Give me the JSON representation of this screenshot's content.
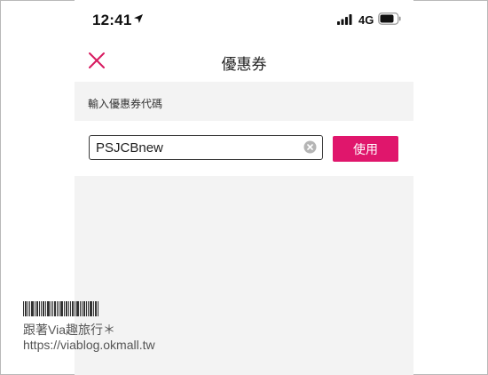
{
  "status_bar": {
    "time": "12:41",
    "network": "4G",
    "icons": [
      "location-arrow-icon",
      "signal-bars-icon",
      "battery-icon"
    ]
  },
  "nav": {
    "title": "優惠券",
    "close_icon": "close-icon",
    "accent_color": "#d81b60"
  },
  "coupon": {
    "section_label": "輸入優惠券代碼",
    "input_value": "PSJCBnew",
    "clear_icon": "clear-circle-icon",
    "apply_label": "使用",
    "apply_color": "#e0166c"
  },
  "watermark": {
    "name": "跟著Via趣旅行＊",
    "url": "https://viablog.okmall.tw"
  }
}
